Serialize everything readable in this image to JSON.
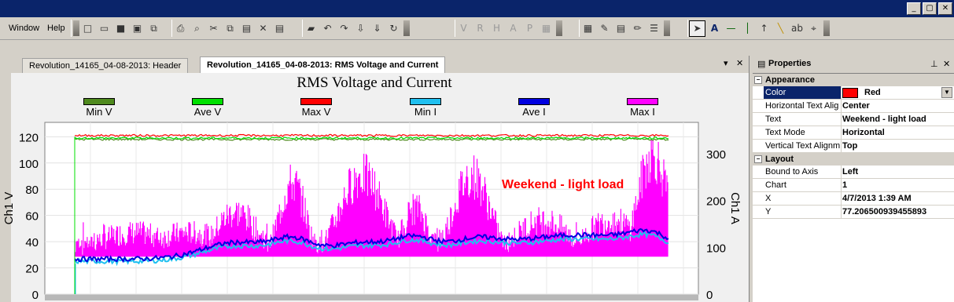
{
  "menu": {
    "items": [
      "Window",
      "Help"
    ]
  },
  "window_controls": [
    "_",
    "▢",
    "✕"
  ],
  "tabs": [
    {
      "label": "Revolution_14165_04-08-2013: Header"
    },
    {
      "label": "Revolution_14165_04-08-2013: RMS Voltage and Current"
    }
  ],
  "chart": {
    "title": "RMS Voltage and Current",
    "annotation": "Weekend - light load"
  },
  "chart_data": {
    "type": "line",
    "title": "RMS Voltage and Current",
    "ylabel": "Ch1 V",
    "y2label": "Ch1 A",
    "ylim": [
      0,
      125
    ],
    "y2lim": [
      0,
      350
    ],
    "y_ticks": [
      "0",
      "20",
      "40",
      "60",
      "80",
      "100",
      "120"
    ],
    "y2_ticks": [
      "0",
      "100",
      "200",
      "300"
    ],
    "grid": true,
    "legend_position": "top",
    "series": [
      {
        "name": "Min V",
        "color": "#4f8a1e",
        "axis": "left",
        "level": 118
      },
      {
        "name": "Ave V",
        "color": "#00e000",
        "axis": "left",
        "level": 119
      },
      {
        "name": "Max V",
        "color": "#ff0000",
        "axis": "left",
        "level": 121
      },
      {
        "name": "Min I",
        "color": "#20c0f0",
        "axis": "right",
        "baseline": 65
      },
      {
        "name": "Ave I",
        "color": "#0000e0",
        "axis": "right",
        "baseline": 70
      },
      {
        "name": "Max I",
        "color": "#ff00ff",
        "axis": "right",
        "baseline": 80
      }
    ]
  },
  "properties": {
    "title": "Properties",
    "categories": [
      {
        "name": "Appearance",
        "rows": [
          {
            "name": "Color",
            "value": "Red"
          },
          {
            "name": "Horizontal Text Alig",
            "value": "Center"
          },
          {
            "name": "Text",
            "value": "Weekend - light load"
          },
          {
            "name": "Text Mode",
            "value": "Horizontal"
          },
          {
            "name": "Vertical Text Alignm",
            "value": "Top"
          }
        ]
      },
      {
        "name": "Layout",
        "rows": [
          {
            "name": "Bound to Axis",
            "value": "Left"
          },
          {
            "name": "Chart",
            "value": "1"
          },
          {
            "name": "X",
            "value": "4/7/2013 1:39 AM"
          },
          {
            "name": "Y",
            "value": "77.206500939455893"
          }
        ]
      }
    ]
  }
}
